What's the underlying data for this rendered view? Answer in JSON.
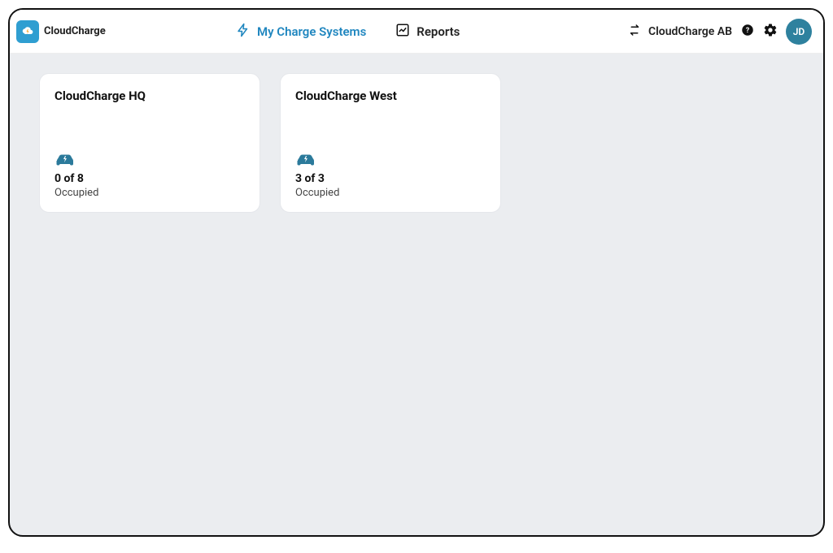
{
  "brand": {
    "name": "CloudCharge"
  },
  "nav": {
    "systems": "My Charge Systems",
    "reports": "Reports"
  },
  "header": {
    "org": "CloudCharge AB",
    "avatar_initials": "JD"
  },
  "cards": [
    {
      "title": "CloudCharge HQ",
      "stat": "0 of 8",
      "label": "Occupied"
    },
    {
      "title": "CloudCharge West",
      "stat": "3 of 3",
      "label": "Occupied"
    }
  ],
  "colors": {
    "accent": "#1f86bf",
    "icon": "#2b7a9b",
    "avatar": "#2e819e"
  }
}
